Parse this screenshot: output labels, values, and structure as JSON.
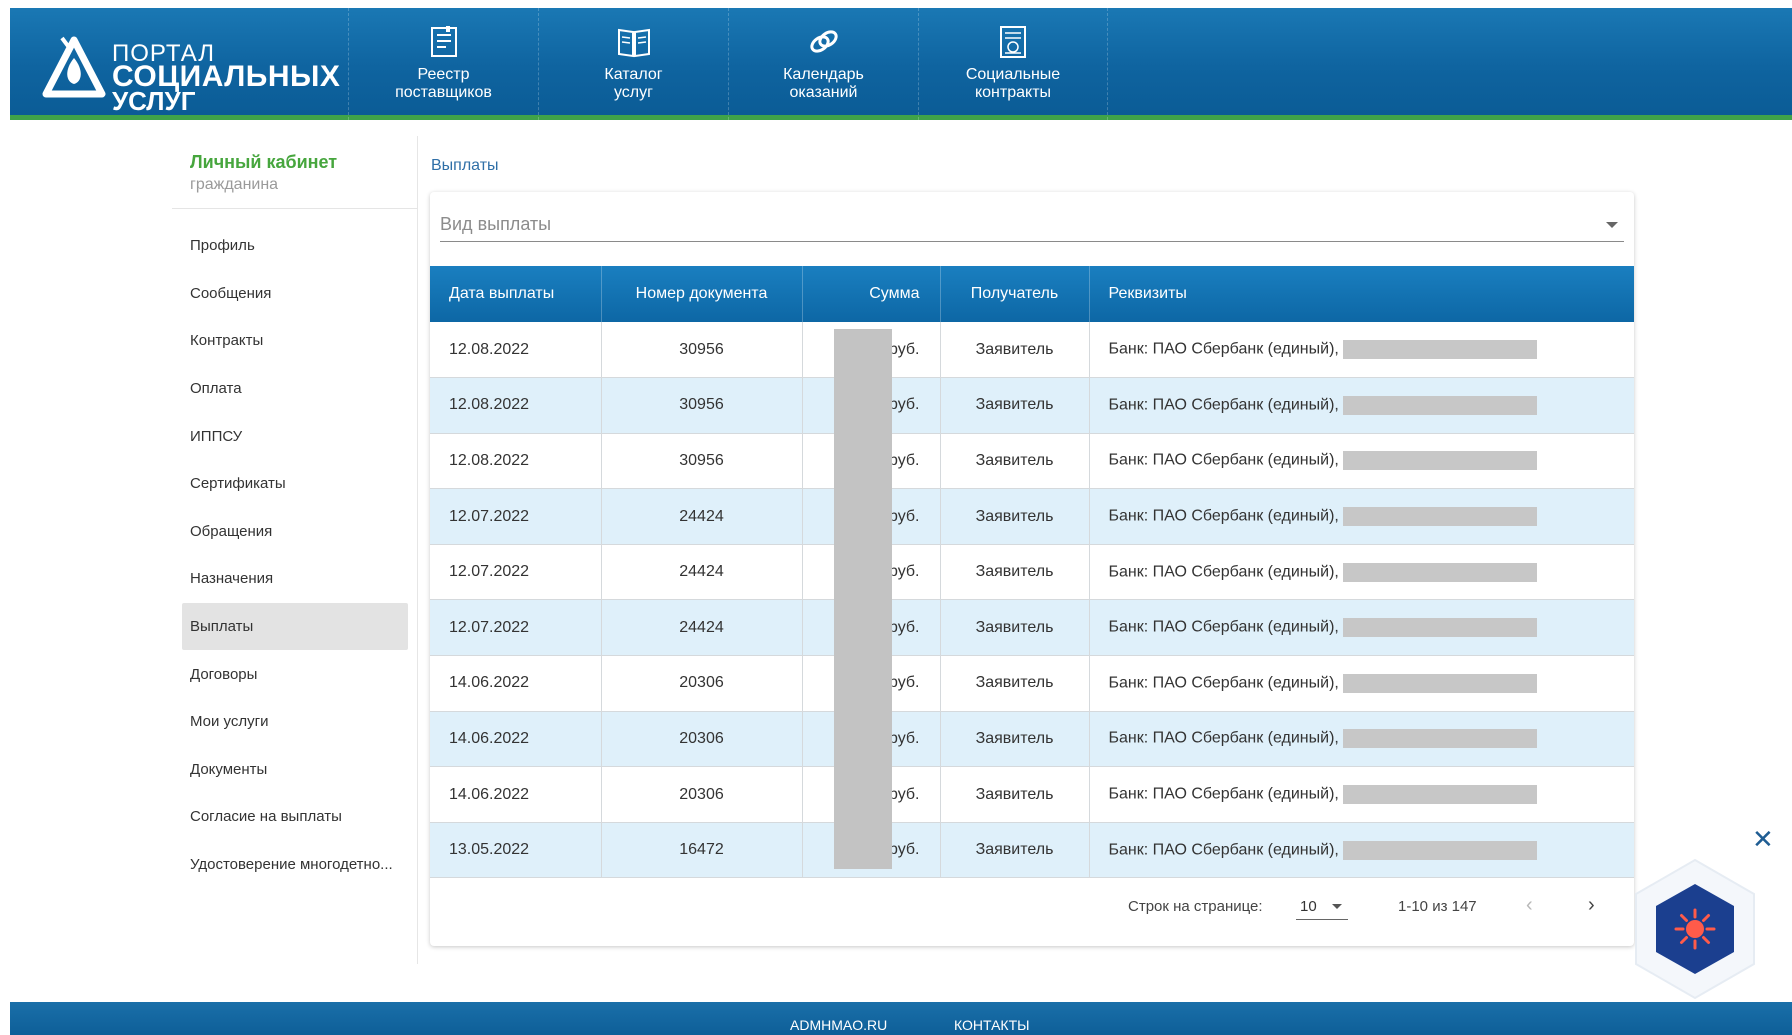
{
  "logo": {
    "line1": "ПОРТАЛ",
    "line2": "СОЦИАЛЬНЫХ",
    "line3": "УСЛУГ"
  },
  "nav": [
    {
      "label": "Реестр\nпоставщиков",
      "icon": "registry-icon"
    },
    {
      "label": "Каталог\nуслуг",
      "icon": "book-icon"
    },
    {
      "label": "Календарь\nоказаний",
      "icon": "calendar-link-icon"
    },
    {
      "label": "Социальные\nконтракты",
      "icon": "contract-icon"
    }
  ],
  "sidebar": {
    "title": "Личный кабинет",
    "subtitle": "гражданина",
    "items": [
      {
        "label": "Профиль"
      },
      {
        "label": "Сообщения"
      },
      {
        "label": "Контракты"
      },
      {
        "label": "Оплата"
      },
      {
        "label": "ИППСУ"
      },
      {
        "label": "Сертификаты"
      },
      {
        "label": "Обращения"
      },
      {
        "label": "Назначения"
      },
      {
        "label": "Выплаты",
        "active": true
      },
      {
        "label": "Договоры"
      },
      {
        "label": "Мои услуги"
      },
      {
        "label": "Документы"
      },
      {
        "label": "Согласие на выплаты"
      },
      {
        "label": "Удостоверение многодетно..."
      }
    ]
  },
  "main": {
    "breadcrumb": "Выплаты",
    "filter_placeholder": "Вид выплаты",
    "columns": [
      "Дата выплаты",
      "Номер документа",
      "Сумма",
      "Получатель",
      "Реквизиты"
    ],
    "rows": [
      {
        "date": "12.08.2022",
        "doc": "30956",
        "sum": "руб.",
        "recipient": "Заявитель",
        "requisites": "Банк: ПАО Сбербанк (единый),"
      },
      {
        "date": "12.08.2022",
        "doc": "30956",
        "sum": "руб.",
        "recipient": "Заявитель",
        "requisites": "Банк: ПАО Сбербанк (единый),"
      },
      {
        "date": "12.08.2022",
        "doc": "30956",
        "sum": "руб.",
        "recipient": "Заявитель",
        "requisites": "Банк: ПАО Сбербанк (единый),"
      },
      {
        "date": "12.07.2022",
        "doc": "24424",
        "sum": "руб.",
        "recipient": "Заявитель",
        "requisites": "Банк: ПАО Сбербанк (единый),"
      },
      {
        "date": "12.07.2022",
        "doc": "24424",
        "sum": "руб.",
        "recipient": "Заявитель",
        "requisites": "Банк: ПАО Сбербанк (единый),"
      },
      {
        "date": "12.07.2022",
        "doc": "24424",
        "sum": "руб.",
        "recipient": "Заявитель",
        "requisites": "Банк: ПАО Сбербанк (единый),"
      },
      {
        "date": "14.06.2022",
        "doc": "20306",
        "sum": "руб.",
        "recipient": "Заявитель",
        "requisites": "Банк: ПАО Сбербанк (единый),"
      },
      {
        "date": "14.06.2022",
        "doc": "20306",
        "sum": "руб.",
        "recipient": "Заявитель",
        "requisites": "Банк: ПАО Сбербанк (единый),"
      },
      {
        "date": "14.06.2022",
        "doc": "20306",
        "sum": "руб.",
        "recipient": "Заявитель",
        "requisites": "Банк: ПАО Сбербанк (единый),"
      },
      {
        "date": "13.05.2022",
        "doc": "16472",
        "sum": "руб.",
        "recipient": "Заявитель",
        "requisites": "Банк: ПАО Сбербанк (единый),"
      }
    ],
    "pagination": {
      "rows_per_page_label": "Строк на странице:",
      "rows_per_page": "10",
      "range": "1-10 из 147",
      "prev": "‹",
      "next": "›"
    }
  },
  "widget": {
    "close": "✕",
    "icon": "sun-icon",
    "color": "#1b3f8f"
  },
  "footer": {
    "links": [
      "ADMHMAO.RU",
      "КОНТАКТЫ"
    ]
  },
  "colors": {
    "header": "#0f64a0",
    "accent_green": "#47a63e",
    "row_alt": "#dff0fa",
    "link": "#2f6fa7"
  }
}
